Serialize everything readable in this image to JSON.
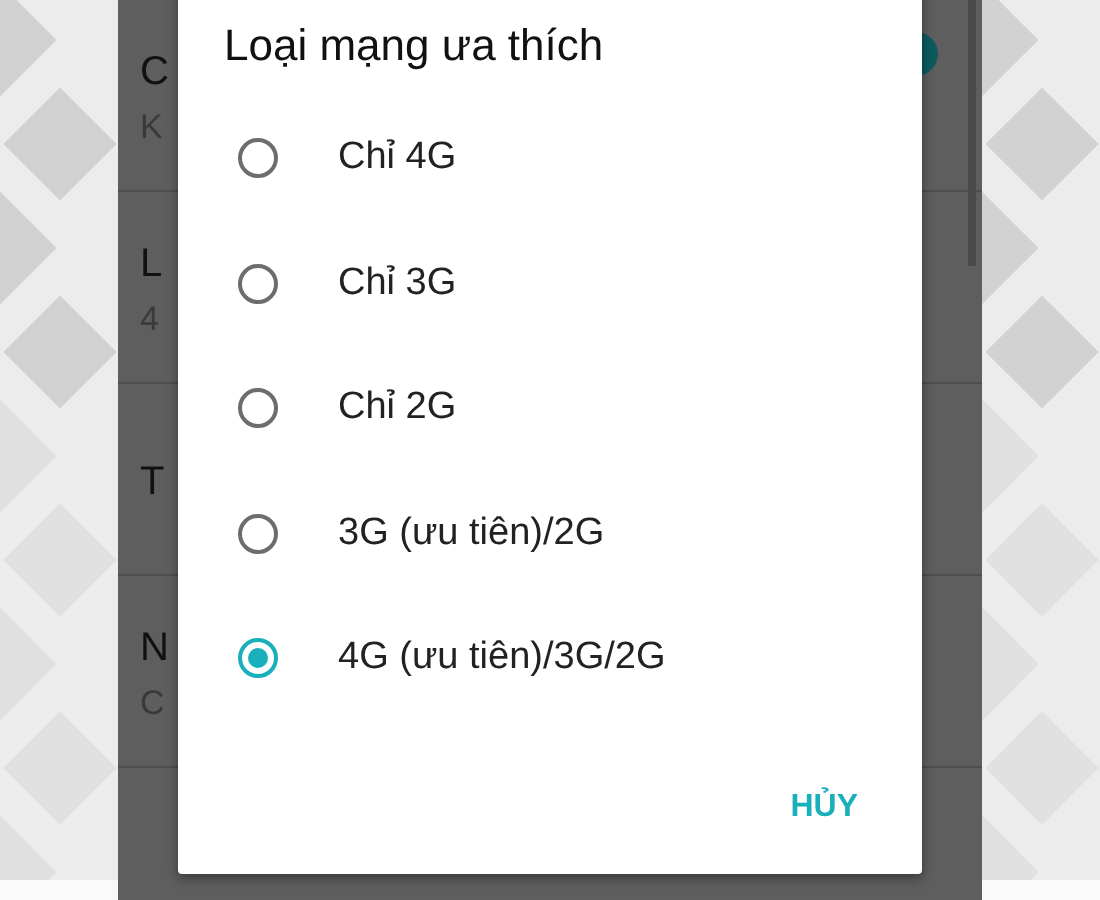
{
  "background_list": [
    {
      "title": "C",
      "subtitle": "K",
      "toggle": true
    },
    {
      "title": "L",
      "subtitle": "4"
    },
    {
      "title": "T"
    },
    {
      "title": "N",
      "subtitle": "C"
    }
  ],
  "dialog": {
    "title": "Loại mạng ưa thích",
    "options": [
      {
        "label": "Chỉ 4G",
        "selected": false
      },
      {
        "label": "Chỉ 3G",
        "selected": false
      },
      {
        "label": "Chỉ 2G",
        "selected": false
      },
      {
        "label": "3G (ưu tiên)/2G",
        "selected": false
      },
      {
        "label": "4G (ưu tiên)/3G/2G",
        "selected": true
      }
    ],
    "buttons": [
      "HỦY"
    ]
  }
}
